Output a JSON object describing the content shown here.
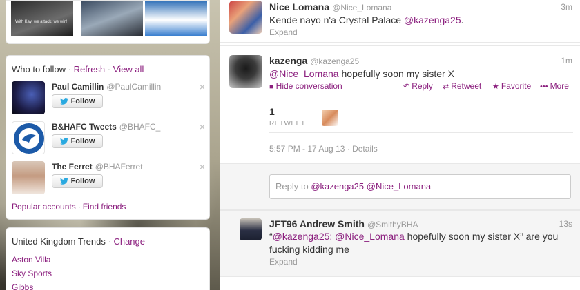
{
  "photos": {
    "caption": "With Kay, we attack, we win!"
  },
  "who_to_follow": {
    "title": "Who to follow",
    "refresh": "Refresh",
    "view_all": "View all",
    "separator": "·",
    "close_glyph": "×",
    "follow_label": "Follow",
    "users": [
      {
        "name": "Paul Camillin",
        "handle": "@PaulCamillin"
      },
      {
        "name": "B&HAFC Tweets",
        "handle": "@BHAFC_"
      },
      {
        "name": "The Ferret",
        "handle": "@BHAFerret"
      }
    ],
    "popular_accounts": "Popular accounts",
    "find_friends": "Find friends"
  },
  "trends": {
    "title": "United Kingdom Trends",
    "change": "Change",
    "items": [
      "Aston Villa",
      "Sky Sports",
      "Gibbs"
    ]
  },
  "timeline": {
    "tweets": [
      {
        "name": "Nice Lomana",
        "handle": "@Nice_Lomana",
        "time": "3m",
        "text_before": "Kende nayo n'a Crystal Palace ",
        "mention": "@kazenga25",
        "text_after": ".",
        "expand": "Expand"
      },
      {
        "name": "kazenga",
        "handle": "@kazenga25",
        "time": "1m",
        "mention": "@Nice_Lomana",
        "text_after": " hopefully soon my sister X",
        "hide_conversation": "Hide conversation",
        "reply": "Reply",
        "retweet": "Retweet",
        "favorite": "Favorite",
        "more": "More",
        "retweet_count": "1",
        "retweet_label": "RETWEET",
        "date": "5:57 PM - 17 Aug 13",
        "details": "Details"
      },
      {
        "name": "JFT96 Andrew Smith",
        "handle": "@SmithyBHA",
        "time": "13s",
        "quote_open": "“",
        "mention1": "@kazenga25",
        "colon": ": ",
        "mention2": "@Nice_Lomana",
        "text_after": " hopefully soon my sister X” are you fucking kidding me",
        "expand": "Expand"
      }
    ],
    "reply_box": {
      "prefix": "Reply to ",
      "mention1": "@kazenga25",
      "mention2": "@Nice_Lomana"
    }
  },
  "colors": {
    "link": "#8b1f7e",
    "muted": "#999999",
    "text": "#333333"
  },
  "icons": {
    "close": "close-icon",
    "bird": "twitter-bird-icon",
    "reply": "reply-icon",
    "retweet": "retweet-icon",
    "favorite": "star-icon",
    "more": "more-dots-icon",
    "conversation": "conversation-bubble-icon"
  }
}
